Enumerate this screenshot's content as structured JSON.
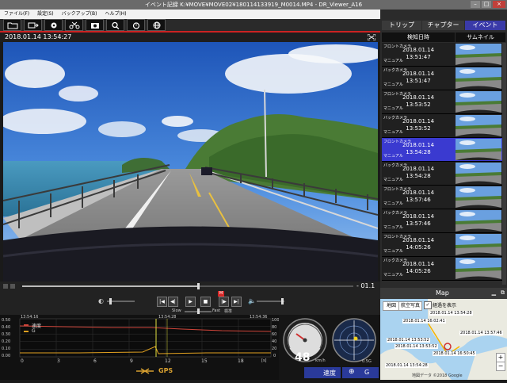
{
  "window": {
    "title": "イベント記録 K:¥MOVE¥MOVE02¥180114133919_M0014.MP4 - DR_Viewer_A16"
  },
  "menu": [
    "ファイル(F)",
    "設定(S)",
    "バックアップ(B)",
    "ヘルプ(H)"
  ],
  "toolbar": {
    "icons": [
      "folder-icon",
      "camera-import-icon",
      "gear-icon",
      "scissors-icon",
      "snapshot-icon",
      "search-icon",
      "timer-icon",
      "globe-icon"
    ]
  },
  "video": {
    "timestamp": "2018.01.14 13:54:27",
    "time_remaining": "- 01.1",
    "progress": 0.53
  },
  "controls": {
    "slow_label": "Slow",
    "fast_label": "Fast",
    "normal_label": "標準",
    "marker": "M",
    "volume": 0.9,
    "brightness": 0.1,
    "speed": 0.5
  },
  "tabs": [
    {
      "label": "トリップ"
    },
    {
      "label": "チャプター"
    },
    {
      "label": "イベント",
      "active": true
    }
  ],
  "list_headers": {
    "date": "検知日時",
    "thumb": "サムネイル"
  },
  "events": [
    {
      "camera": "フロントカメラ",
      "date": "2018.01.14",
      "time": "13:51:47",
      "mode": "マニュアル"
    },
    {
      "camera": "バックカメラ",
      "date": "2018.01.14",
      "time": "13:51:47",
      "mode": "マニュアル"
    },
    {
      "camera": "フロントカメラ",
      "date": "2018.01.14",
      "time": "13:53:52",
      "mode": "マニュアル"
    },
    {
      "camera": "バックカメラ",
      "date": "2018.01.14",
      "time": "13:53:52",
      "mode": "マニュアル"
    },
    {
      "camera": "フロントカメラ",
      "date": "2018.01.14",
      "time": "13:54:28",
      "mode": "マニュアル",
      "selected": true
    },
    {
      "camera": "バックカメラ",
      "date": "2018.01.14",
      "time": "13:54:28",
      "mode": "マニュアル"
    },
    {
      "camera": "フロントカメラ",
      "date": "2018.01.14",
      "time": "13:57:46",
      "mode": "マニュアル"
    },
    {
      "camera": "バックカメラ",
      "date": "2018.01.14",
      "time": "13:57:46",
      "mode": "マニュアル"
    },
    {
      "camera": "フロントカメラ",
      "date": "2018.01.14",
      "time": "14:05:26",
      "mode": "マニュアル"
    },
    {
      "camera": "バックカメラ",
      "date": "2018.01.14",
      "time": "14:05:26",
      "mode": "マニュアル"
    }
  ],
  "graph": {
    "yticks": [
      "0.50",
      "0.40",
      "0.30",
      "0.20",
      "0.10",
      "0.00"
    ],
    "xticks": [
      "0",
      "3",
      "6",
      "9",
      "12",
      "15",
      "18"
    ],
    "xunit": "[s]",
    "rticks": [
      "100",
      "80",
      "60",
      "40",
      "20",
      "0"
    ],
    "start_time": "13:54:16",
    "cursor_time": "13:54:28",
    "end_time": "13:54:36",
    "legend": [
      {
        "name": "速度",
        "color": "#d0453a"
      },
      {
        "name": "G",
        "color": "#e0a020"
      }
    ],
    "gps_label": "GPS"
  },
  "gauges": {
    "speed": "48",
    "speed_unit": "km/h",
    "g_value": "0.5G",
    "speed_label": "速度",
    "g_label": "G"
  },
  "map": {
    "title": "Map",
    "type_map": "地図",
    "type_aerial": "航空写真",
    "checkbox_label": "経過を表示",
    "labels": [
      "2018.01.14 13:54:28",
      "2018.01.14 16:02:41",
      "2018.01.14 13:57:46",
      "2018.01.14 13:53:52",
      "2018.01.14 13:53:52",
      "2018.01.14 16:50:45",
      "2018.01.14 13:54:28"
    ],
    "footer": "地図データ ©2018 Google"
  }
}
